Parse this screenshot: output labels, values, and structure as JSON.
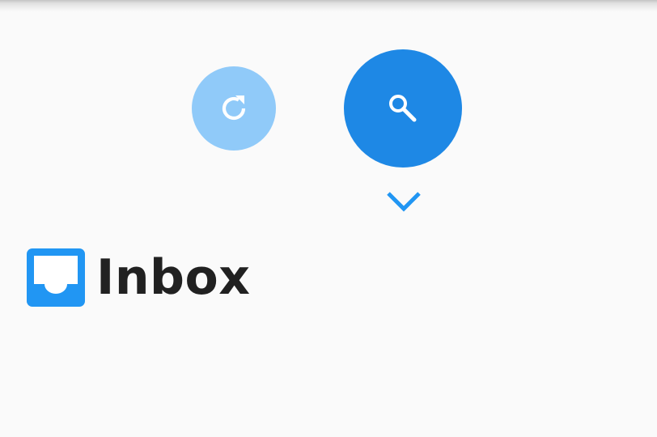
{
  "header": {
    "title": "Inbox",
    "icon": "inbox-icon"
  },
  "actions": {
    "refresh": {
      "icon": "refresh-icon"
    },
    "search": {
      "icon": "search-icon"
    },
    "expand": {
      "icon": "chevron-down-icon"
    }
  },
  "colors": {
    "primary": "#1e88e5",
    "refresh_fab": "#90caf9",
    "icon_blue": "#2196f3",
    "background": "#fafafa",
    "title_text": "#212121"
  }
}
